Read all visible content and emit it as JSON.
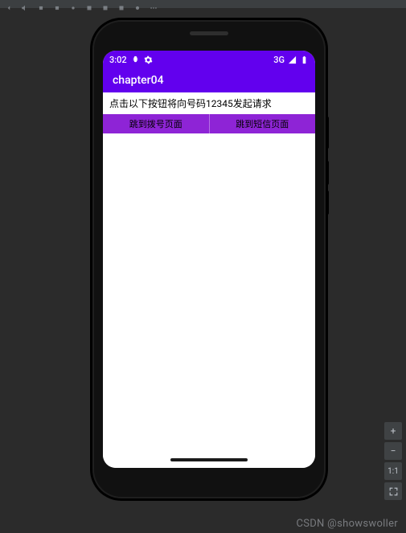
{
  "status_bar": {
    "clock": "3:02",
    "network_label": "3G"
  },
  "app_bar": {
    "title": "chapter04"
  },
  "body": {
    "description": "点击以下按钮将向号码12345发起请求",
    "button_dial": "跳到拨号页面",
    "button_sms": "跳到短信页面"
  },
  "emulator_controls": {
    "zoom_in": "+",
    "zoom_out": "−",
    "one_to_one": "1:1"
  },
  "watermark": "CSDN @showswoller"
}
